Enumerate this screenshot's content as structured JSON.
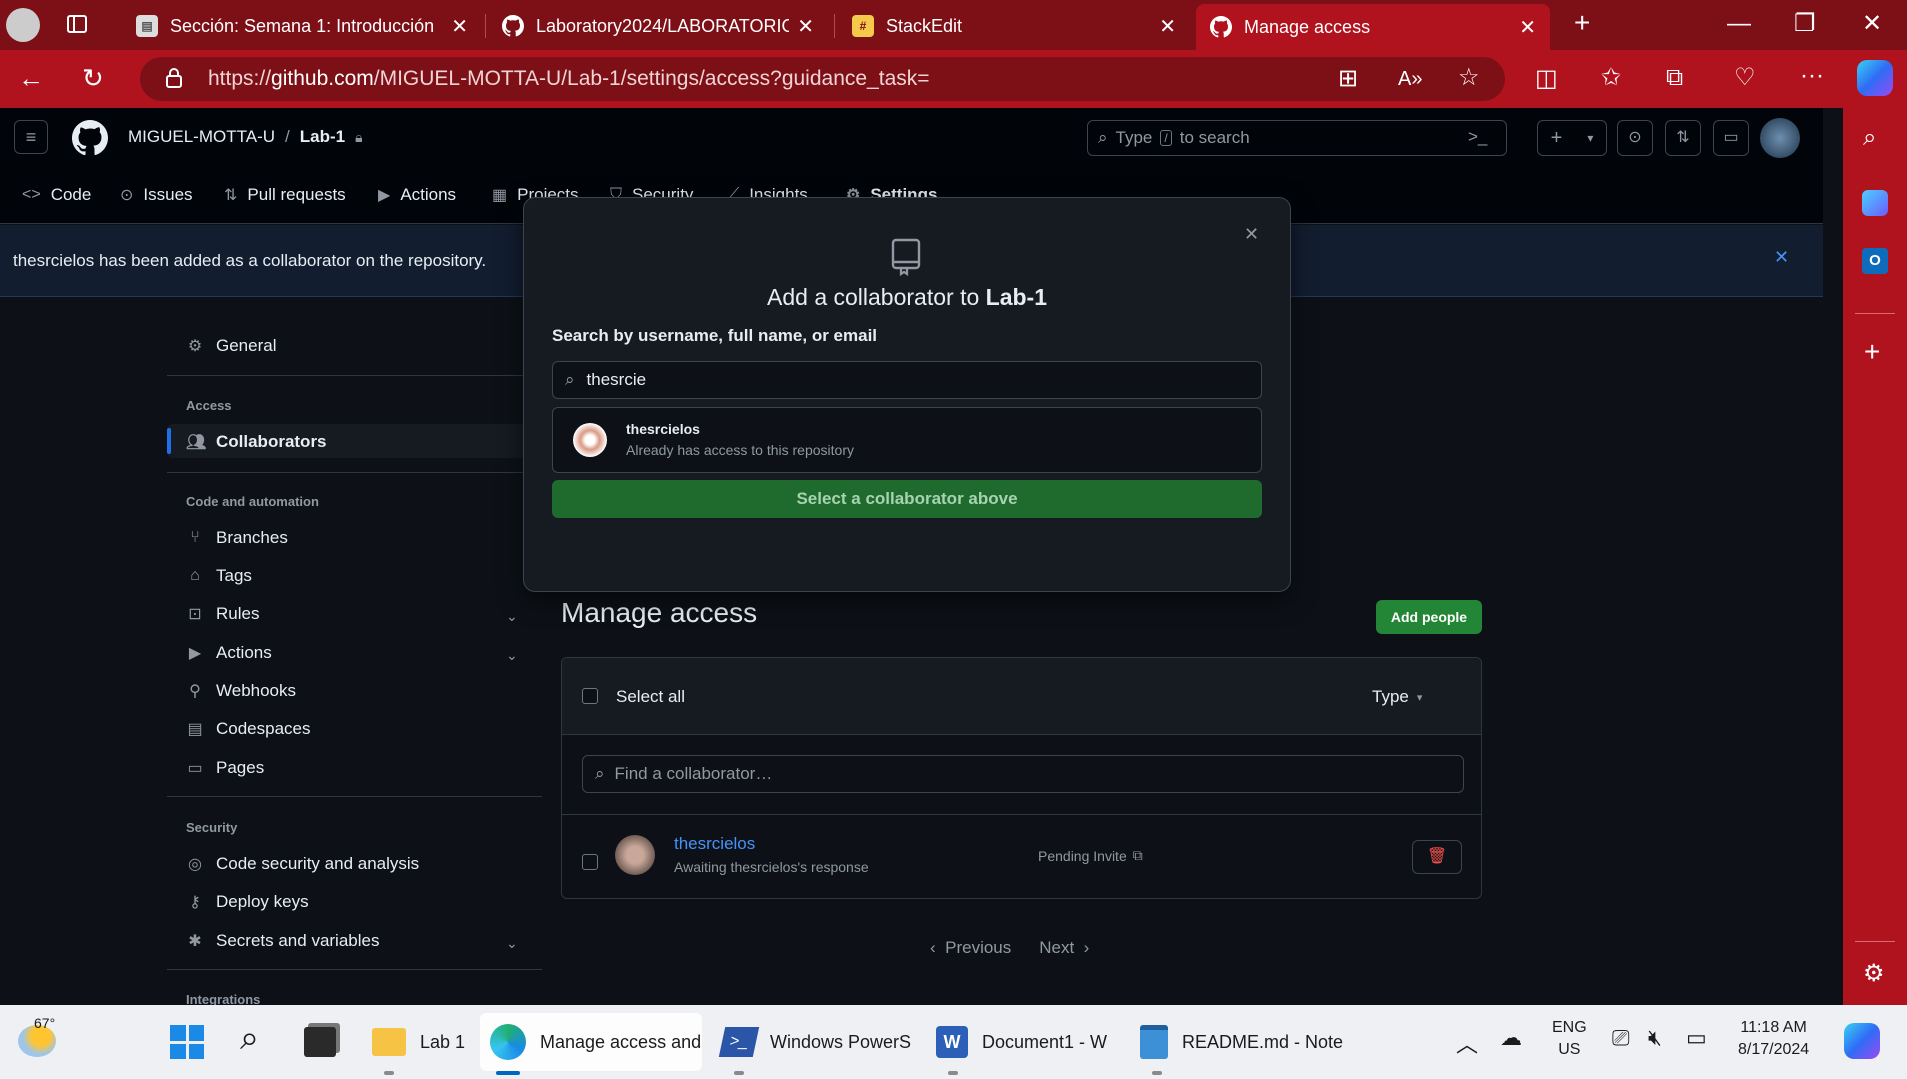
{
  "browser": {
    "tabs": [
      {
        "title": "Sección: Semana 1: Introducción",
        "active": false
      },
      {
        "title": "Laboratory2024/LABORATORIOS_",
        "active": false
      },
      {
        "title": "StackEdit",
        "active": false
      },
      {
        "title": "Manage access",
        "active": true
      }
    ],
    "url_prefix": "https://",
    "url_host": "github.com",
    "url_path": "/MIGUEL-MOTTA-U/Lab-1/settings/access?guidance_task=",
    "accent": "#b0121e"
  },
  "github": {
    "owner": "MIGUEL-MOTTA-U",
    "separator": "/",
    "repo": "Lab-1",
    "search_placeholder_pre": "Type",
    "search_key": "/",
    "search_placeholder_post": "to search",
    "nav": [
      "Code",
      "Issues",
      "Pull requests",
      "Actions",
      "Projects",
      "Security",
      "Insights",
      "Settings"
    ],
    "flash": "thesrcielos has been added as a collaborator on the repository.",
    "sidebar": {
      "general": "General",
      "access_head": "Access",
      "collaborators": "Collaborators",
      "code_head": "Code and automation",
      "branches": "Branches",
      "tags": "Tags",
      "rules": "Rules",
      "actions": "Actions",
      "webhooks": "Webhooks",
      "codespaces": "Codespaces",
      "pages": "Pages",
      "security_head": "Security",
      "code_security": "Code security and analysis",
      "deploy_keys": "Deploy keys",
      "secrets": "Secrets and variables",
      "integrations_head": "Integrations"
    },
    "modal": {
      "title_pre": "Add a collaborator to",
      "title_repo": "Lab-1",
      "search_label": "Search by username, full name, or email",
      "search_value": "thesrcie",
      "result_name": "thesrcielos",
      "result_note": "Already has access to this repository",
      "button": "Select a collaborator above"
    },
    "manage": {
      "title": "Manage access",
      "add_button": "Add people",
      "select_all": "Select all",
      "type_label": "Type",
      "find_placeholder": "Find a collaborator…",
      "user_name": "thesrcielos",
      "user_status": "Awaiting thesrcielos's response",
      "pending": "Pending Invite",
      "previous": "Previous",
      "next": "Next"
    }
  },
  "taskbar": {
    "weather": "67°",
    "apps": [
      {
        "label": "Lab 1"
      },
      {
        "label": "Manage access and"
      },
      {
        "label": "Windows PowerS"
      },
      {
        "label": "Document1 - W"
      },
      {
        "label": "README.md - Note"
      }
    ],
    "lang1": "ENG",
    "lang2": "US",
    "time": "11:18 AM",
    "date": "8/17/2024"
  }
}
